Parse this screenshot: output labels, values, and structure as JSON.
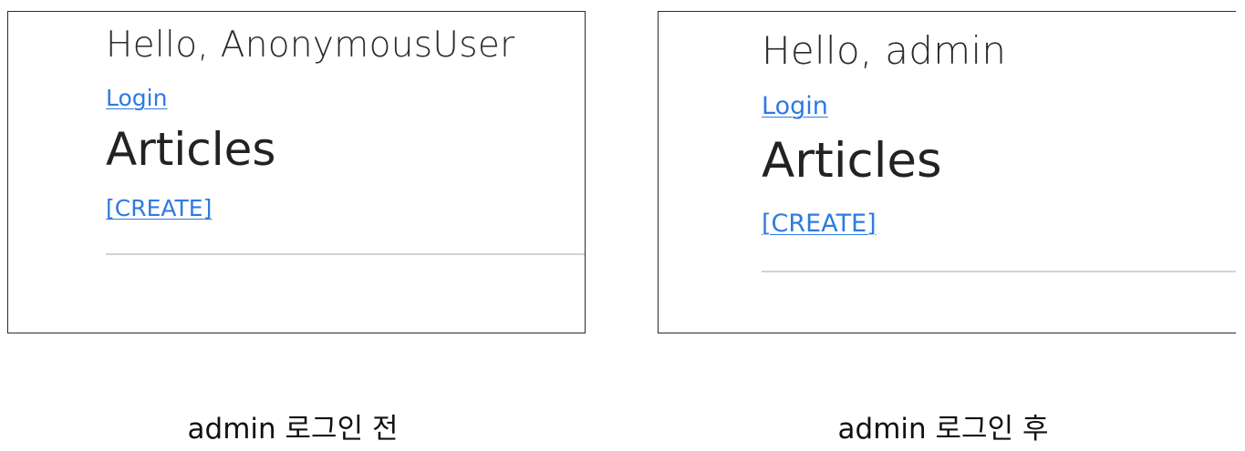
{
  "before": {
    "greeting": "Hello, AnonymousUser",
    "login_link": "Login",
    "page_title": "Articles",
    "create_link": "[CREATE]",
    "caption": "admin 로그인 전"
  },
  "after": {
    "greeting": "Hello, admin",
    "login_link": "Login",
    "page_title": "Articles",
    "create_link": "[CREATE]",
    "caption": "admin 로그인 후"
  },
  "colors": {
    "link": "#2f7ae0",
    "text": "#222222",
    "border": "#2b2b2b",
    "divider": "#d2d2d2"
  }
}
